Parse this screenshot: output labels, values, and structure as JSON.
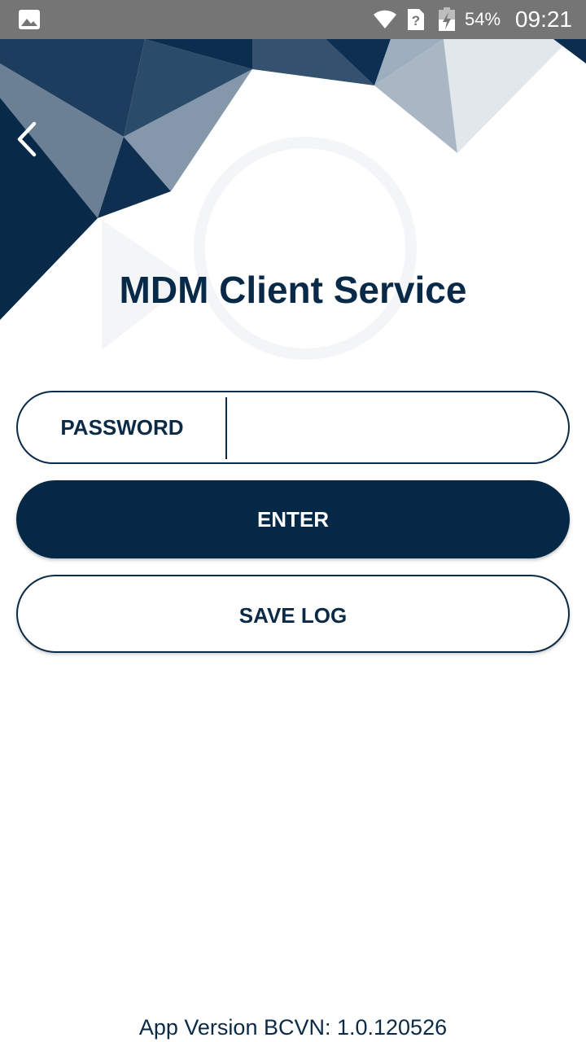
{
  "status_bar": {
    "notification_icon": "gallery-icon",
    "wifi_icon": "wifi-icon",
    "sim_icon": "sim-unknown-icon",
    "battery_icon": "battery-charging-icon",
    "battery_percent": "54%",
    "time": "09:21"
  },
  "header": {
    "back_icon": "chevron-left-icon",
    "title": "MDM Client Service"
  },
  "form": {
    "password_label": "PASSWORD",
    "password_value": "",
    "password_placeholder": "",
    "enter_label": "ENTER",
    "save_log_label": "SAVE LOG"
  },
  "footer": {
    "version": "App Version BCVN: 1.0.120526"
  },
  "colors": {
    "primary": "#052846",
    "status_bar": "#757575",
    "background": "#ffffff"
  }
}
